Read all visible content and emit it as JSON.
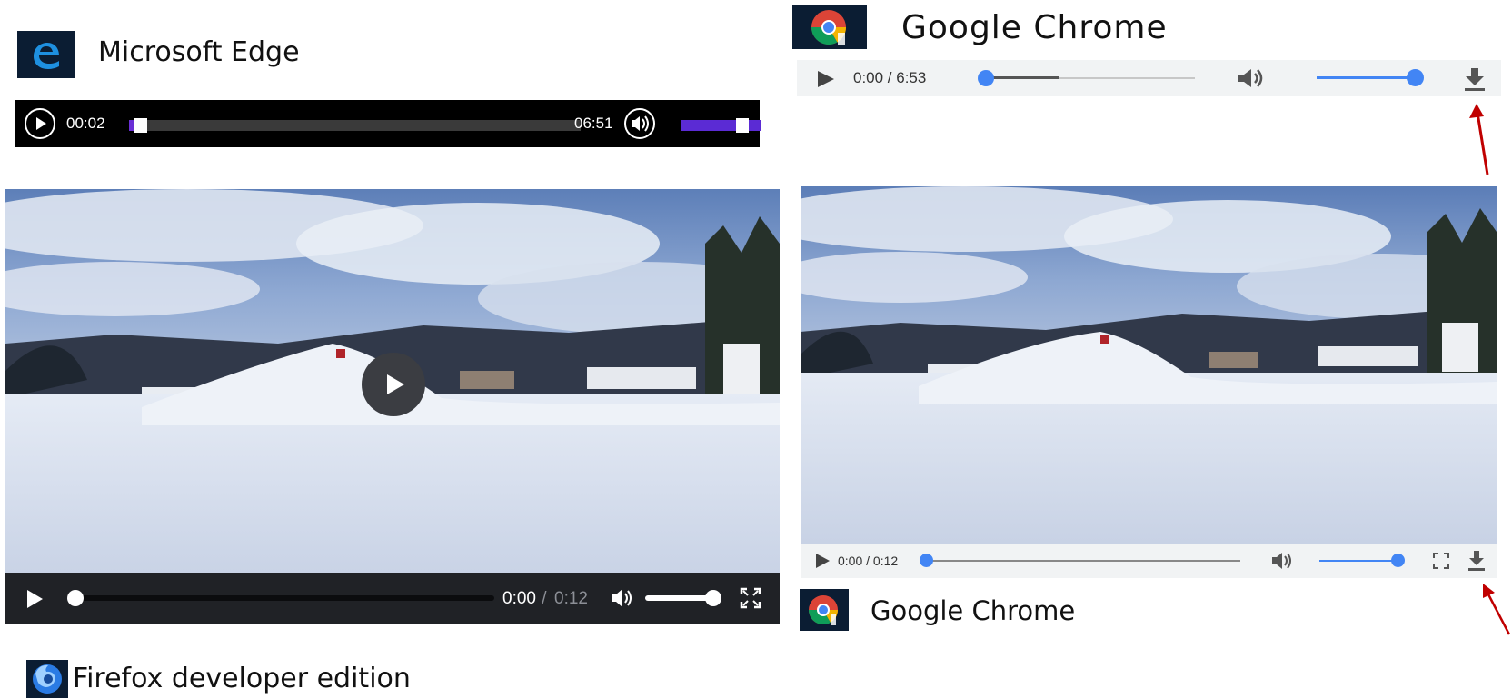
{
  "edge": {
    "label": "Microsoft Edge",
    "logo_icon": "edge-logo-icon",
    "audio": {
      "current_time": "00:02",
      "duration": "06:51",
      "progress_fraction": 0.01,
      "volume_fraction": 0.9
    }
  },
  "chrome_top": {
    "label": "Google Chrome",
    "logo_icon": "chrome-logo-icon",
    "audio": {
      "time_display": "0:00 / 6:53",
      "progress_fraction": 0.0,
      "volume_fraction": 1.0
    }
  },
  "firefox": {
    "label": "Firefox developer edition",
    "logo_icon": "firefox-logo-icon",
    "video": {
      "current_time": "0:00",
      "separator": " / ",
      "duration": "0:12",
      "progress_fraction": 0.0,
      "volume_fraction": 1.0
    }
  },
  "chrome_bottom": {
    "label": "Google Chrome",
    "logo_icon": "chrome-logo-icon",
    "video": {
      "time_display": "0:00 / 0:12",
      "progress_fraction": 0.0,
      "volume_fraction": 1.0
    }
  },
  "colors": {
    "edge_purple": "#6a2fd6",
    "chrome_blue": "#4285f4",
    "annotation_red": "#c00000",
    "firefox_bar": "#202226"
  },
  "annotations": [
    "red-arrow-pointing-to-download-icon",
    "red-arrow-pointing-to-download-icon"
  ]
}
